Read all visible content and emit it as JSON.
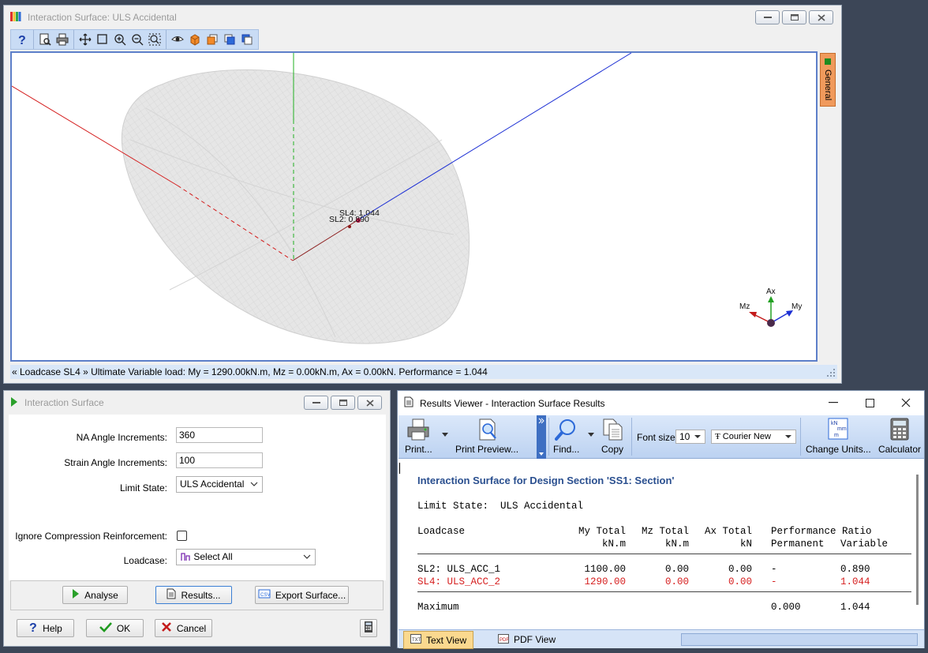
{
  "surface_window": {
    "title": "Interaction Surface: ULS Accidental",
    "side_tab": "General",
    "status": "« Loadcase SL4 »  Ultimate Variable load: My = 1290.00kN.m, Mz = 0.00kN.m, Ax = 0.00kN.  Performance = 1.044",
    "point_labels": {
      "sl4": "SL4: 1.044",
      "sl2": "SL2: 0.890"
    },
    "axis_labels": {
      "ax": "Ax",
      "mz": "Mz",
      "my": "My"
    }
  },
  "dialog": {
    "title": "Interaction Surface",
    "na_angle_label": "NA Angle Increments:",
    "na_angle_value": "360",
    "strain_angle_label": "Strain Angle Increments:",
    "strain_angle_value": "100",
    "limit_state_label": "Limit State:",
    "limit_state_value": "ULS Accidental",
    "ignore_label": "Ignore Compression Reinforcement:",
    "loadcase_label": "Loadcase:",
    "loadcase_value": "Select All",
    "analyse": "Analyse",
    "results": "Results...",
    "export": "Export Surface...",
    "help": "Help",
    "ok": "OK",
    "cancel": "Cancel"
  },
  "results_viewer": {
    "title": "Results Viewer - Interaction Surface Results",
    "ribbon": {
      "print": "Print...",
      "print_preview": "Print Preview...",
      "find": "Find...",
      "copy": "Copy",
      "font_size_label": "Font size",
      "font_size_value": "10",
      "font_name": "Courier New",
      "change_units": "Change Units...",
      "calculator": "Calculator",
      "units_icon_text": "kN m mm m"
    },
    "report": {
      "heading": "Interaction Surface for Design Section 'SS1: Section'",
      "limit_state": "Limit State:  ULS Accidental",
      "col_loadcase": "Loadcase",
      "col_my": "My Total",
      "col_mz": "Mz Total",
      "col_ax": "Ax Total",
      "col_perf": "Performance Ratio",
      "unit_my": "kN.m",
      "unit_mz": "kN.m",
      "unit_ax": "kN",
      "col_perm": "Permanent",
      "col_var": "Variable",
      "rows": [
        {
          "loadcase": "SL2: ULS_ACC_1",
          "my": "1100.00",
          "mz": "0.00",
          "ax": "0.00",
          "perm": "-",
          "var": "0.890"
        },
        {
          "loadcase": "SL4: ULS_ACC_2",
          "my": "1290.00",
          "mz": "0.00",
          "ax": "0.00",
          "perm": "-",
          "var": "1.044"
        }
      ],
      "max_label": "Maximum",
      "max_perm": "0.000",
      "max_var": "1.044"
    },
    "tabs": {
      "text_view": "Text View",
      "pdf_view": "PDF View"
    }
  }
}
